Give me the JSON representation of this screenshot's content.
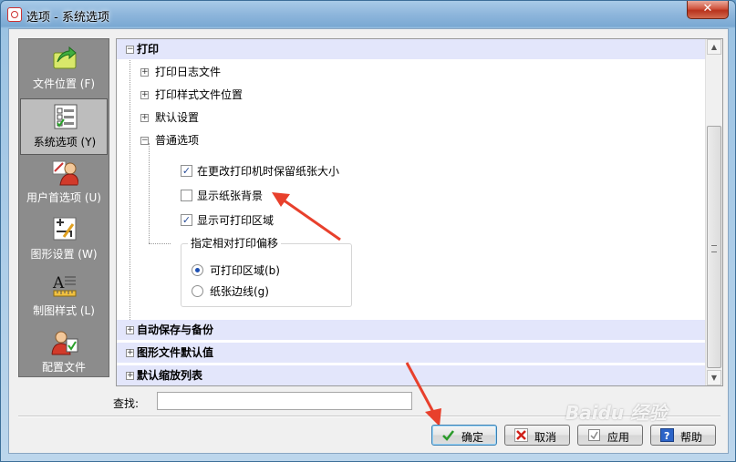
{
  "window": {
    "title": "选项 - 系统选项",
    "close_glyph": "✕"
  },
  "nav": {
    "items": [
      {
        "label": "文件位置 (F)",
        "icon": "folder-arrow-icon",
        "selected": false
      },
      {
        "label": "系统选项 (Y)",
        "icon": "checklist-icon",
        "selected": true
      },
      {
        "label": "用户首选项 (U)",
        "icon": "user-preferences-icon",
        "selected": false
      },
      {
        "label": "图形设置 (W)",
        "icon": "graphics-settings-icon",
        "selected": false
      },
      {
        "label": "制图样式 (L)",
        "icon": "drawing-style-icon",
        "selected": false
      },
      {
        "label": "配置文件",
        "icon": "profile-icon",
        "selected": false
      }
    ]
  },
  "tree": {
    "print_header": "打印",
    "print_log": "打印日志文件",
    "print_style_location": "打印样式文件位置",
    "default_settings": "默认设置",
    "general_options": "普通选项",
    "keep_paper_size": "在更改打印机时保留纸张大小",
    "show_paper_background": "显示纸张背景",
    "show_printable_area": "显示可打印区域",
    "offset_group_title": "指定相对打印偏移",
    "offset_printable": "可打印区域(b)",
    "offset_paper_edge": "纸张边线(g)",
    "autosave": "自动保存与备份",
    "drawing_defaults": "图形文件默认值",
    "default_scale_list": "默认缩放列表",
    "expand_glyph": "+",
    "collapse_glyph": "−",
    "check_glyph": "✓"
  },
  "search": {
    "label": "查找:",
    "value": ""
  },
  "buttons": {
    "ok": "确定",
    "cancel": "取消",
    "apply": "应用",
    "help": "帮助"
  },
  "watermark": "Baidu 经验",
  "colors": {
    "annotation_arrow": "#e8402c",
    "tree_highlight": "#e3e6fb"
  }
}
